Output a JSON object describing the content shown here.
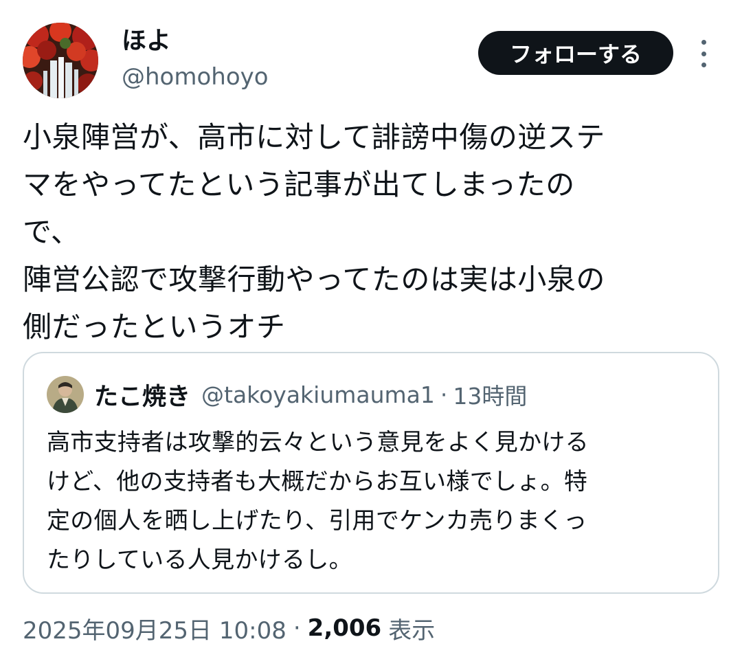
{
  "tweet": {
    "author_name": "ほよ",
    "author_handle": "@homohoyo",
    "follow_label": "フォローする",
    "text": "小泉陣営が、高市に対して誹謗中傷の逆ステ\nマをやってたという記事が出てしまったの\nで、\n陣営公認で攻撃行動やってたのは実は小泉の\n側だったというオチ",
    "date": "2025年09月25日 10:08",
    "views_count": "2,006",
    "views_label": "表示"
  },
  "quote": {
    "author_name": "たこ焼き",
    "author_handle": "@takoyakiumauma1",
    "separator": "·",
    "time": "13時間",
    "text": "高市支持者は攻撃的云々という意見をよく見かける\nけど、他の支持者も大概だからお互い様でしょ。特\n定の個人を晒し上げたり、引用でケンカ売りまくっ\nたりしている人見かけるし。"
  },
  "icons": {
    "more": "more-vertical-icon"
  },
  "colors": {
    "text_primary": "#0f1419",
    "text_secondary": "#536471",
    "button_bg": "#0f1419",
    "border": "#cfd9de"
  }
}
